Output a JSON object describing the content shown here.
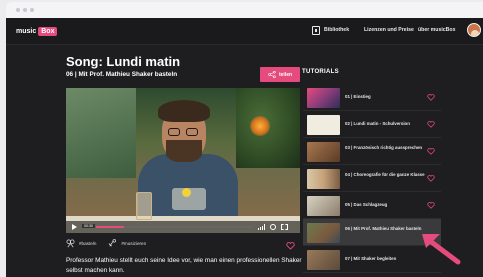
{
  "brand": {
    "name_a": "music",
    "name_b": "Box"
  },
  "nav": {
    "library": "Bibliothek",
    "licenses": "Lizenzen und Preise",
    "about": "über musicBox"
  },
  "page": {
    "title": "Song: Lundi matin",
    "subtitle": "06 | Mit Prof. Mathieu Shaker basteln",
    "share_label": "teilen"
  },
  "player": {
    "time": "00:30",
    "progress": 0.18
  },
  "tags": [
    {
      "icon": "craft-icon",
      "label": "#basteln"
    },
    {
      "icon": "music-icon",
      "label": "#musizieren"
    }
  ],
  "description": "Professor Mathieu stellt euch seine Idee vor, wie man einen professionellen Shaker selbst machen kann.",
  "tutorials": {
    "heading": "TUTORIALS",
    "items": [
      {
        "label": "01 | Einstieg",
        "active": false
      },
      {
        "label": "02 | Lundi matin - Schulversion",
        "active": false
      },
      {
        "label": "03 | Französisch richtig aussprechen",
        "active": false
      },
      {
        "label": "04 | Choreografie für die ganze Klasse",
        "active": false
      },
      {
        "label": "05 | Das Schlagzeug",
        "active": false
      },
      {
        "label": "06 | Mit Prof. Mathieu Shaker basteln",
        "active": true
      },
      {
        "label": "07 | Mit Shaker begleiten",
        "active": false
      }
    ]
  },
  "colors": {
    "accent": "#e64b7d",
    "background": "#1e1e20"
  }
}
